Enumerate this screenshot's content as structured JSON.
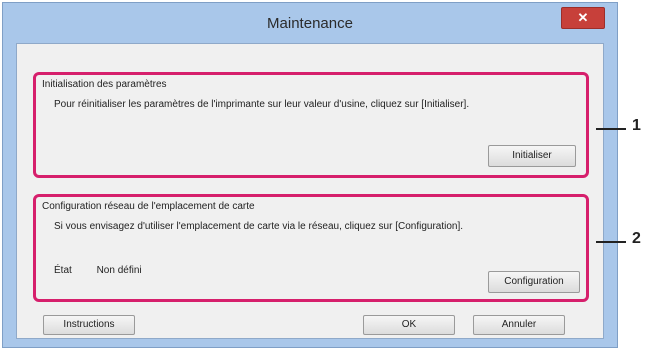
{
  "window": {
    "title": "Maintenance",
    "close_label": "✕"
  },
  "group1": {
    "title": "Initialisation des paramètres",
    "description": "Pour réinitialiser les paramètres de l'imprimante sur leur valeur d'usine, cliquez sur [Initialiser].",
    "button_label": "Initialiser"
  },
  "group2": {
    "title": "Configuration réseau de l'emplacement de carte",
    "description": "Si vous envisagez d'utiliser l'emplacement de carte via le réseau, cliquez sur [Configuration].",
    "state_label": "État",
    "state_value": "Non défini",
    "button_label": "Configuration"
  },
  "footer": {
    "instructions_label": "Instructions",
    "ok_label": "OK",
    "cancel_label": "Annuler"
  },
  "callouts": [
    "1",
    "2"
  ]
}
